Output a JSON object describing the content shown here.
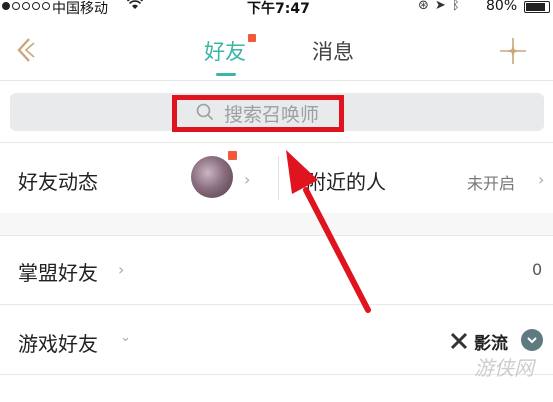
{
  "status_bar": {
    "carrier": "中国移动",
    "time": "下午7:47",
    "battery_percent": "80%",
    "battery_level": 0.8
  },
  "nav": {
    "tabs": [
      {
        "label": "好友",
        "active": true,
        "has_badge": true
      },
      {
        "label": "消息",
        "active": false,
        "has_badge": false
      }
    ]
  },
  "search": {
    "placeholder": "搜索召唤师"
  },
  "rows": {
    "friend_feed": {
      "label": "好友动态"
    },
    "nearby": {
      "label": "附近的人",
      "status": "未开启"
    },
    "league_friends": {
      "label": "掌盟好友",
      "count": "0"
    },
    "game_friends": {
      "label": "游戏好友",
      "filter": "影流"
    }
  },
  "watermark": "游侠网",
  "colors": {
    "accent": "#3bb5a6",
    "badge": "#f05a3a",
    "highlight": "#e0141e"
  },
  "icons": [
    "back-icon",
    "add-icon",
    "search-icon",
    "chevron-right-icon",
    "chevron-down-icon",
    "wifi-icon",
    "lock-icon",
    "location-icon",
    "bluetooth-icon",
    "battery-icon"
  ]
}
